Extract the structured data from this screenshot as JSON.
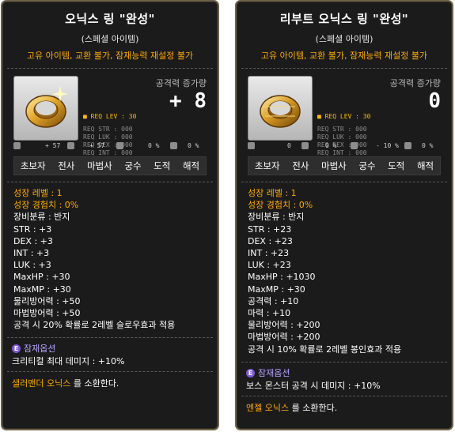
{
  "left": {
    "title": "오닉스 링 \"완성\"",
    "subtitle": "(스페셜 아이템)",
    "restrictions": "고유 아이템, 교환 불가, 잠재능력 재설정 불가",
    "attack_label": "공격력 증가량",
    "attack_value": "+ 8",
    "req_lev": "REQ LEV :   30",
    "req_str": "REQ STR : 000",
    "req_luk": "REQ LUK : 000",
    "req_dex": "REQ DEX : 000",
    "req_int": "REQ INT : 000",
    "mini_stats": [
      "+ 57",
      "+ 57",
      "0 %",
      "0 %"
    ],
    "jobs": [
      "초보자",
      "전사",
      "마법사",
      "궁수",
      "도적",
      "해적"
    ],
    "stats_yellow": [
      "성장 레벨 : 1",
      "성장 경험치 : 0%"
    ],
    "stats": [
      "장비분류 : 반지",
      "STR : +3",
      "DEX : +3",
      "INT : +3",
      "LUK : +3",
      "MaxHP : +30",
      "MaxMP : +30",
      "물리방어력 : +50",
      "마법방어력 : +50",
      "공격 시 20% 확률로 2레벨 슬로우효과 적용"
    ],
    "potential_badge": "E",
    "potential_title": "잠재옵션",
    "potential_line": "크리티컬 최대 데미지 : +10%",
    "summon_name": "샐러맨더 오닉스",
    "summon_rest": " 를 소환한다."
  },
  "right": {
    "title": "리부트 오닉스 링 \"완성\"",
    "subtitle": "(스페셜 아이템)",
    "restrictions": "고유 아이템, 교환 불가, 잠재능력 재설정 불가",
    "attack_label": "공격력 증가량",
    "attack_value": "0",
    "req_lev": "REQ LEV :   30",
    "req_str": "REQ STR : 000",
    "req_luk": "REQ LUK : 000",
    "req_dex": "REQ DEX : 000",
    "req_int": "REQ INT : 000",
    "mini_stats": [
      "0",
      "0 %",
      "- 10 %",
      "0 %"
    ],
    "jobs": [
      "초보자",
      "전사",
      "마법사",
      "궁수",
      "도적",
      "해적"
    ],
    "stats_yellow": [
      "성장 레벨 : 1",
      "성장 경험치 : 0%"
    ],
    "stats": [
      "장비분류 : 반지",
      "STR : +23",
      "DEX : +23",
      "INT : +23",
      "LUK : +23",
      "MaxHP : +1030",
      "MaxMP : +30",
      "공격력 : +10",
      "마력 : +10",
      "물리방어력 : +200",
      "마법방어력 : +200",
      "공격 시 10% 확률로 2레벨 봉인효과 적용"
    ],
    "potential_badge": "E",
    "potential_title": "잠재옵션",
    "potential_line": "보스 몬스터 공격 시 데미지 : +10%",
    "summon_name": "엔젤 오닉스",
    "summon_rest": " 를 소환한다."
  },
  "colors": {
    "yellow": "#ffaa00",
    "panel": "#1b1b1c",
    "border": "#6d6248",
    "potential": "#b7a3ff"
  },
  "icons": [
    "ring-icon",
    "stat-icon",
    "potential-icon"
  ]
}
